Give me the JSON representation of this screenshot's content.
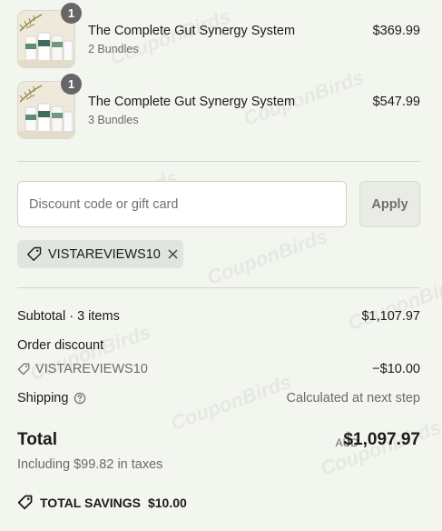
{
  "items": [
    {
      "qty": "1",
      "title": "The Complete Gut Synergy System",
      "variant": "2 Bundles",
      "price": "$369.99"
    },
    {
      "qty": "1",
      "title": "The Complete Gut Synergy System",
      "variant": "3 Bundles",
      "price": "$547.99"
    }
  ],
  "discount": {
    "placeholder": "Discount code or gift card",
    "apply_label": "Apply",
    "applied_code": "VISTAREVIEWS10"
  },
  "summary": {
    "subtotal_label": "Subtotal · 3 items",
    "subtotal_value": "$1,107.97",
    "order_discount_label": "Order discount",
    "discount_code": "VISTAREVIEWS10",
    "discount_value": "−$10.00",
    "shipping_label": "Shipping",
    "shipping_value": "Calculated at next step",
    "total_label": "Total",
    "currency": "AUD",
    "total_value": "$1,097.97",
    "taxes_text": "Including $99.82 in taxes",
    "savings_label": "TOTAL SAVINGS",
    "savings_value": "$10.00"
  },
  "watermark": "CouponBirds",
  "colors": {
    "background": "#f3f5ef",
    "chip": "#dfe6df",
    "badge": "#666666"
  }
}
